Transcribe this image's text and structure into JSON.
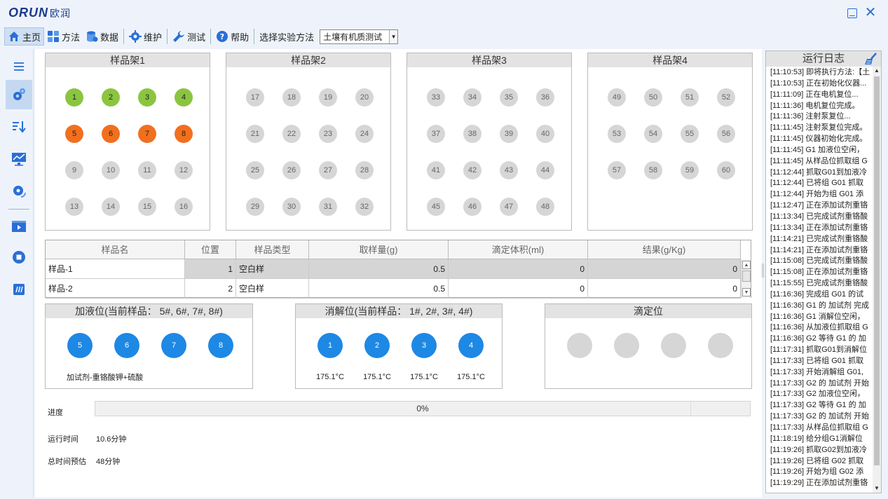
{
  "app": {
    "logo": "ORUN",
    "logo_cn": "欧润"
  },
  "toolbar": {
    "home": "主页",
    "method": "方法",
    "data": "数据",
    "maintain": "维护",
    "test": "测试",
    "help": "帮助",
    "select_method_label": "选择实验方法",
    "selected_method": "土壤有机质测试"
  },
  "racks": [
    {
      "title": "样品架1",
      "slots": [
        {
          "n": "1",
          "s": "green"
        },
        {
          "n": "2",
          "s": "green"
        },
        {
          "n": "3",
          "s": "green"
        },
        {
          "n": "4",
          "s": "green"
        },
        {
          "n": "5",
          "s": "orange"
        },
        {
          "n": "6",
          "s": "orange"
        },
        {
          "n": "7",
          "s": "orange"
        },
        {
          "n": "8",
          "s": "orange"
        },
        {
          "n": "9",
          "s": "empty"
        },
        {
          "n": "10",
          "s": "empty"
        },
        {
          "n": "11",
          "s": "empty"
        },
        {
          "n": "12",
          "s": "empty"
        },
        {
          "n": "13",
          "s": "empty"
        },
        {
          "n": "14",
          "s": "empty"
        },
        {
          "n": "15",
          "s": "empty"
        },
        {
          "n": "16",
          "s": "empty"
        }
      ]
    },
    {
      "title": "样品架2",
      "slots": [
        {
          "n": "17",
          "s": "empty"
        },
        {
          "n": "18",
          "s": "empty"
        },
        {
          "n": "19",
          "s": "empty"
        },
        {
          "n": "20",
          "s": "empty"
        },
        {
          "n": "21",
          "s": "empty"
        },
        {
          "n": "22",
          "s": "empty"
        },
        {
          "n": "23",
          "s": "empty"
        },
        {
          "n": "24",
          "s": "empty"
        },
        {
          "n": "25",
          "s": "empty"
        },
        {
          "n": "26",
          "s": "empty"
        },
        {
          "n": "27",
          "s": "empty"
        },
        {
          "n": "28",
          "s": "empty"
        },
        {
          "n": "29",
          "s": "empty"
        },
        {
          "n": "30",
          "s": "empty"
        },
        {
          "n": "31",
          "s": "empty"
        },
        {
          "n": "32",
          "s": "empty"
        }
      ]
    },
    {
      "title": "样品架3",
      "slots": [
        {
          "n": "33",
          "s": "empty"
        },
        {
          "n": "34",
          "s": "empty"
        },
        {
          "n": "35",
          "s": "empty"
        },
        {
          "n": "36",
          "s": "empty"
        },
        {
          "n": "37",
          "s": "empty"
        },
        {
          "n": "38",
          "s": "empty"
        },
        {
          "n": "39",
          "s": "empty"
        },
        {
          "n": "40",
          "s": "empty"
        },
        {
          "n": "41",
          "s": "empty"
        },
        {
          "n": "42",
          "s": "empty"
        },
        {
          "n": "43",
          "s": "empty"
        },
        {
          "n": "44",
          "s": "empty"
        },
        {
          "n": "45",
          "s": "empty"
        },
        {
          "n": "46",
          "s": "empty"
        },
        {
          "n": "47",
          "s": "empty"
        },
        {
          "n": "48",
          "s": "empty"
        }
      ]
    },
    {
      "title": "样品架4",
      "slots": [
        {
          "n": "49",
          "s": "empty"
        },
        {
          "n": "50",
          "s": "empty"
        },
        {
          "n": "51",
          "s": "empty"
        },
        {
          "n": "52",
          "s": "empty"
        },
        {
          "n": "53",
          "s": "empty"
        },
        {
          "n": "54",
          "s": "empty"
        },
        {
          "n": "55",
          "s": "empty"
        },
        {
          "n": "56",
          "s": "empty"
        },
        {
          "n": "57",
          "s": "empty"
        },
        {
          "n": "58",
          "s": "empty"
        },
        {
          "n": "59",
          "s": "empty"
        },
        {
          "n": "60",
          "s": "empty"
        }
      ]
    }
  ],
  "table": {
    "headers": [
      "样品名",
      "位置",
      "样品类型",
      "取样量(g)",
      "滴定体积(ml)",
      "结果(g/Kg)"
    ],
    "rows": [
      [
        "样品-1",
        "1",
        "空白样",
        "0.5",
        "0",
        "0"
      ],
      [
        "样品-2",
        "2",
        "空白样",
        "0.5",
        "0",
        "0"
      ]
    ]
  },
  "stations": {
    "add": {
      "title": "加液位(当前样品： 5#, 6#, 7#, 8#)",
      "slots": [
        "5",
        "6",
        "7",
        "8"
      ],
      "reagent": "加试剂-重铬酸钾+硫酸"
    },
    "digest": {
      "title": "消解位(当前样品： 1#, 2#, 3#, 4#)",
      "slots": [
        "1",
        "2",
        "3",
        "4"
      ],
      "temps": [
        "175.1°C",
        "175.1°C",
        "175.1°C",
        "175.1°C"
      ]
    },
    "titrate": {
      "title": "滴定位"
    }
  },
  "progress": {
    "label": "进度",
    "value": 0,
    "text": "0%"
  },
  "run_time": {
    "label": "运行时间",
    "value": "10.6分钟"
  },
  "total_time": {
    "label": "总时间预估",
    "value": "48分钟"
  },
  "log": {
    "title": "运行日志",
    "lines": [
      "[11:10:53] 即将执行方法:【土",
      "[11:10:53] 正在初始化仪器...",
      "[11:11:09] 正在电机复位...",
      "[11:11:36] 电机复位完成。",
      "[11:11:36] 注射泵复位...",
      "[11:11:45] 注射泵复位完成。",
      "[11:11:45] 仪器初始化完成。",
      "[11:11:45] G1 加液位空闲，",
      "[11:11:45] 从样品位抓取组 G",
      "[11:12:44] 抓取G01到加液冷",
      "[11:12:44] 已将组 G01 抓取",
      "[11:12:44] 开始为组 G01 添",
      "[11:12:47] 正在添加试剂重铬",
      "[11:13:34] 已完成试剂重铬酸",
      "[11:13:34] 正在添加试剂重铬",
      "[11:14:21] 已完成试剂重铬酸",
      "[11:14:21] 正在添加试剂重铬",
      "[11:15:08] 已完成试剂重铬酸",
      "[11:15:08] 正在添加试剂重铬",
      "[11:15:55] 已完成试剂重铬酸",
      "[11:16:36] 完成组 G01 的试",
      "[11:16:36] G1 的 加试剂 完成",
      "[11:16:36] G1 消解位空闲，",
      "[11:16:36] 从加液位抓取组 G",
      "[11:16:36] G2 等待 G1 的 加",
      "[11:17:31] 抓取G01到消解位",
      "[11:17:33] 已将组 G01 抓取",
      "[11:17:33] 开始消解组 G01,",
      "[11:17:33] G2 的 加试剂 开始",
      "[11:17:33] G2 加液位空闲，",
      "[11:17:33] G2 等待 G1 的 加",
      "[11:17:33] G2 的 加试剂 开始",
      "[11:17:33] 从样品位抓取组 G",
      "[11:18:19] 给分组G1消解位",
      "[11:19:26] 抓取G02到加液冷",
      "[11:19:26] 已将组 G02 抓取",
      "[11:19:26] 开始为组 G02 添",
      "[11:19:29] 正在添加试剂重铬"
    ]
  },
  "colors": {
    "accent": "#1e88e5",
    "done": "#8bc540",
    "in_progress": "#f26f1e",
    "empty": "#d6d6d6"
  }
}
